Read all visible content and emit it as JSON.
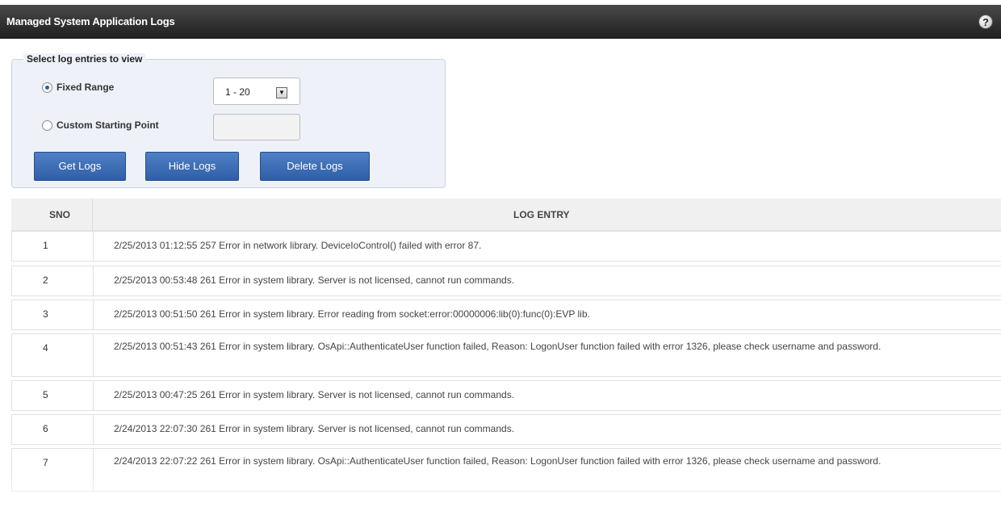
{
  "header": {
    "title": "Managed System Application Logs",
    "help_icon": "help-question-icon"
  },
  "filter": {
    "legend": "Select log entries to view",
    "fixed_range_label": "Fixed Range",
    "custom_start_label": "Custom Starting Point",
    "range_value": "1 - 20",
    "custom_start_value": "",
    "selected": "fixed"
  },
  "buttons": {
    "get_logs": "Get Logs",
    "hide_logs": "Hide Logs",
    "delete_logs": "Delete Logs"
  },
  "table": {
    "columns": [
      "SNO",
      "LOG ENTRY"
    ],
    "rows": [
      {
        "sno": "1",
        "entry": "2/25/2013 01:12:55 257 Error in network library. DeviceIoControl() failed with error 87."
      },
      {
        "sno": "2",
        "entry": "2/25/2013 00:53:48 261 Error in system library. Server is not licensed, cannot run commands."
      },
      {
        "sno": "3",
        "entry": "2/25/2013 00:51:50 261 Error in system library. Error reading from socket:error:00000006:lib(0):func(0):EVP lib."
      },
      {
        "sno": "4",
        "entry": "2/25/2013 00:51:43 261 Error in system library. OsApi::AuthenticateUser function failed, Reason: LogonUser function failed with error 1326, please check username and password."
      },
      {
        "sno": "5",
        "entry": "2/25/2013 00:47:25 261 Error in system library. Server is not licensed, cannot run commands."
      },
      {
        "sno": "6",
        "entry": "2/24/2013 22:07:30 261 Error in system library. Server is not licensed, cannot run commands."
      },
      {
        "sno": "7",
        "entry": "2/24/2013 22:07:22 261 Error in system library. OsApi::AuthenticateUser function failed, Reason: LogonUser function failed with error 1326, please check username and password."
      }
    ]
  },
  "colors": {
    "title_bar": "#2b2b2b",
    "button": "#3e6fb7",
    "panel": "#eef2f8"
  }
}
